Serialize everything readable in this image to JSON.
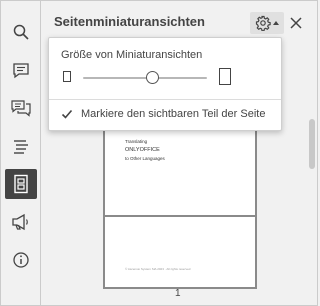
{
  "panel": {
    "title": "Seitenminiaturansichten"
  },
  "sidebar": {
    "items": [
      {
        "name": "search-icon",
        "active": false
      },
      {
        "name": "comments-icon",
        "active": false
      },
      {
        "name": "chat-icon",
        "active": false
      },
      {
        "name": "navigation-icon",
        "active": false
      },
      {
        "name": "page-thumbnails-icon",
        "active": true
      },
      {
        "name": "feedback-icon",
        "active": false
      },
      {
        "name": "about-icon",
        "active": false
      }
    ]
  },
  "settings_popup": {
    "size_label": "Größe von Miniaturansichten",
    "slider_value": 0.56,
    "checkbox_label": "Markiere den sichtbaren Teil der Seite",
    "checkbox_checked": true
  },
  "thumbnail": {
    "line1": "Translating",
    "line2": "ONLYOFFICE",
    "line3": "to Other Languages",
    "footer": "© Ascensio System SIA 2023 · All rights reserved",
    "page_number": "1"
  },
  "colors": {
    "accent_active": "#444444",
    "panel_bg": "#f1f1f1"
  }
}
